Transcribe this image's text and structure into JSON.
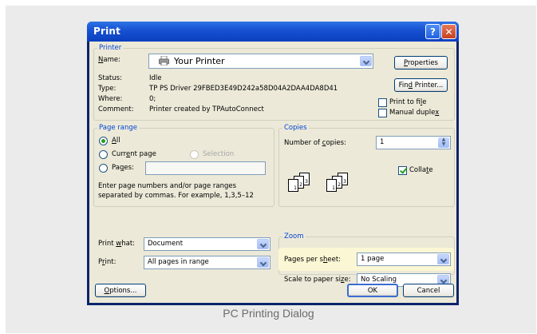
{
  "window": {
    "title": "Print"
  },
  "printer": {
    "legend": "Printer",
    "name_label": "Name:",
    "name_value": "Your Printer",
    "status_label": "Status:",
    "status_value": "Idle",
    "type_label": "Type:",
    "type_value": "TP PS Driver 29FBED3E49D242a58D04A2DAA4DA8D41",
    "where_label": "Where:",
    "where_value": "0;",
    "comment_label": "Comment:",
    "comment_value": "Printer created by TPAutoConnect",
    "properties_label": "Properties",
    "find_printer_label": "Find Printer...",
    "print_to_file_label": "Print to file",
    "manual_duplex_label": "Manual duplex"
  },
  "page_range": {
    "legend": "Page range",
    "all_label": "All",
    "current_page_label": "Current page",
    "selection_label": "Selection",
    "pages_label": "Pages:",
    "pages_value": "",
    "hint": "Enter page numbers and/or page ranges separated by commas.  For example, 1,3,5–12"
  },
  "copies": {
    "legend": "Copies",
    "number_label": "Number of copies:",
    "number_value": "1",
    "collate_label": "Collate",
    "collate_checked": true
  },
  "print_what": {
    "label": "Print what:",
    "value": "Document"
  },
  "print": {
    "label": "Print:",
    "value": "All pages in range"
  },
  "zoom": {
    "legend": "Zoom",
    "pages_per_sheet_label": "Pages per sheet:",
    "pages_per_sheet_value": "1 page",
    "scale_label": "Scale to paper size:",
    "scale_value": "No Scaling"
  },
  "buttons": {
    "options": "Options...",
    "ok": "OK",
    "cancel": "Cancel"
  },
  "caption": "PC Printing Dialog"
}
